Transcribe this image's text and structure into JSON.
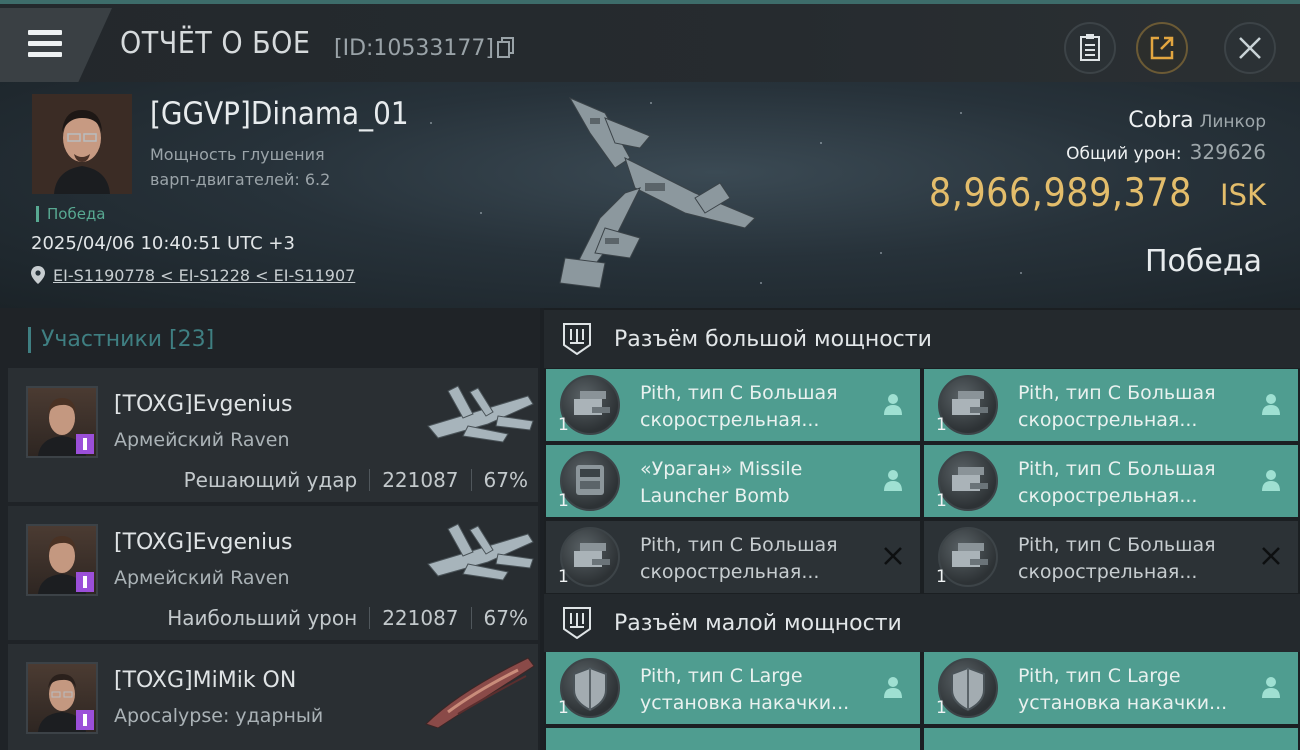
{
  "header": {
    "title": "ОТЧЁТ О БОЕ",
    "report_id": "[ID:10533177]"
  },
  "victim": {
    "pilot": "[GGVP]Dinama_01",
    "warp_label": "Мощность глушения варп-двигателей: 6.2",
    "result_badge": "Победа",
    "time": "2025/04/06 10:40:51 UTC +3",
    "location": "EI-S1190778 < EI-S1228 < EI-S11907",
    "ship": "Cobra",
    "ship_class": "Линкор",
    "damage_label": "Общий урон:",
    "damage_value": "329626",
    "isk_value": "8,966,989,378",
    "isk_unit": "ISK",
    "result": "Победа"
  },
  "participants": {
    "title": "Участники [23]",
    "items": [
      {
        "name": "[TOXG]Evgenius",
        "ship": "Армейский Raven",
        "role": "Решающий удар",
        "damage": "221087",
        "percent": "67%"
      },
      {
        "name": "[TOXG]Evgenius",
        "ship": "Армейский Raven",
        "role": "Наибольший урон",
        "damage": "221087",
        "percent": "67%"
      },
      {
        "name": "[TOXG]MiMik ON",
        "ship": "Apocalypse: ударный",
        "role": "",
        "damage": "",
        "percent": ""
      }
    ]
  },
  "fittings": {
    "high_title": "Разъём большой мощности",
    "low_title": "Разъём малой мощности",
    "high": [
      {
        "name1": "Pith, тип C Большая",
        "name2": "скорострельная...",
        "qty": "1",
        "status": "dropped"
      },
      {
        "name1": "Pith, тип C Большая",
        "name2": "скорострельная...",
        "qty": "1",
        "status": "dropped"
      },
      {
        "name1": "«Ураган» Missile",
        "name2": "Launcher Bomb",
        "qty": "1",
        "status": "dropped"
      },
      {
        "name1": "Pith, тип C Большая",
        "name2": "скорострельная...",
        "qty": "1",
        "status": "dropped"
      },
      {
        "name1": "Pith, тип C Большая",
        "name2": "скорострельная...",
        "qty": "1",
        "status": "destroyed"
      },
      {
        "name1": "Pith, тип C Большая",
        "name2": "скорострельная...",
        "qty": "1",
        "status": "destroyed"
      }
    ],
    "low": [
      {
        "name1": "Pith, тип C Large",
        "name2": "установка накачки...",
        "qty": "1",
        "status": "dropped"
      },
      {
        "name1": "Pith, тип C Large",
        "name2": "установка накачки...",
        "qty": "1",
        "status": "dropped"
      }
    ]
  },
  "colors": {
    "accent_teal": "#4f9d90",
    "isk_gold": "#e3bd6b",
    "victory_green": "#58a992"
  }
}
